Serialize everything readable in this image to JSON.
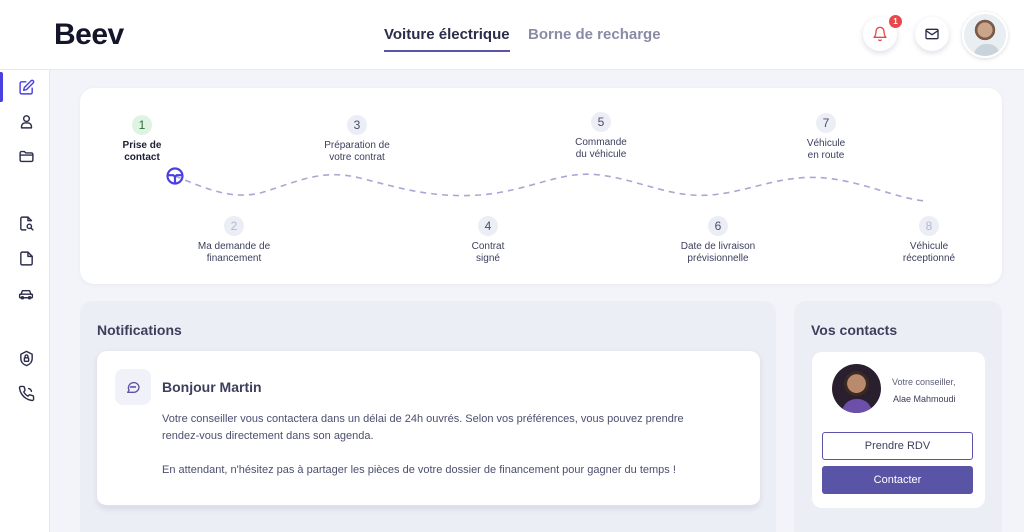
{
  "header": {
    "logo": "Beev",
    "tabs": [
      {
        "label": "Voiture électrique",
        "active": true
      },
      {
        "label": "Borne de recharge",
        "active": false
      }
    ],
    "notification_count": "1",
    "icons": [
      "bell-icon",
      "mail-icon",
      "user-avatar"
    ]
  },
  "sidebar": {
    "icons": [
      "edit-icon",
      "user-icon",
      "folder-icon",
      "document-search-icon",
      "file-icon",
      "car-icon",
      "lock-shield-icon",
      "phone-icon"
    ],
    "active": "edit-icon"
  },
  "steps": [
    {
      "num": "1",
      "label_line1": "Prise de",
      "label_line2": "contact"
    },
    {
      "num": "2",
      "label_line1": "Ma demande de",
      "label_line2": "financement"
    },
    {
      "num": "3",
      "label_line1": "Préparation de",
      "label_line2": "votre contrat"
    },
    {
      "num": "4",
      "label_line1": "Contrat",
      "label_line2": "signé"
    },
    {
      "num": "5",
      "label_line1": "Commande",
      "label_line2": "du véhicule"
    },
    {
      "num": "6",
      "label_line1": "Date de livraison",
      "label_line2": "prévisionnelle"
    },
    {
      "num": "7",
      "label_line1": "Véhicule",
      "label_line2": "en route"
    },
    {
      "num": "8",
      "label_line1": "Véhicule",
      "label_line2": "réceptionné"
    }
  ],
  "notifications": {
    "title": "Notifications",
    "card": {
      "title": "Bonjour Martin",
      "line1": "Votre conseiller vous contactera dans un délai de 24h ouvrés. Selon vos préférences, vous pouvez prendre",
      "line2": "rendez-vous directement dans son agenda.",
      "line3": "En attendant, n'hésitez pas à partager les pièces de votre dossier de financement pour gagner du temps !"
    }
  },
  "contacts": {
    "title": "Vos contacts",
    "role": "Votre conseiller,",
    "name": "Alae Mahmoudi",
    "rdv_button": "Prendre RDV",
    "contact_button": "Contacter"
  },
  "colors": {
    "accent": "#5a54a6",
    "active_indicator": "#4a3fe0",
    "badge": "#e5484d",
    "done_step": "#dff3e3"
  }
}
